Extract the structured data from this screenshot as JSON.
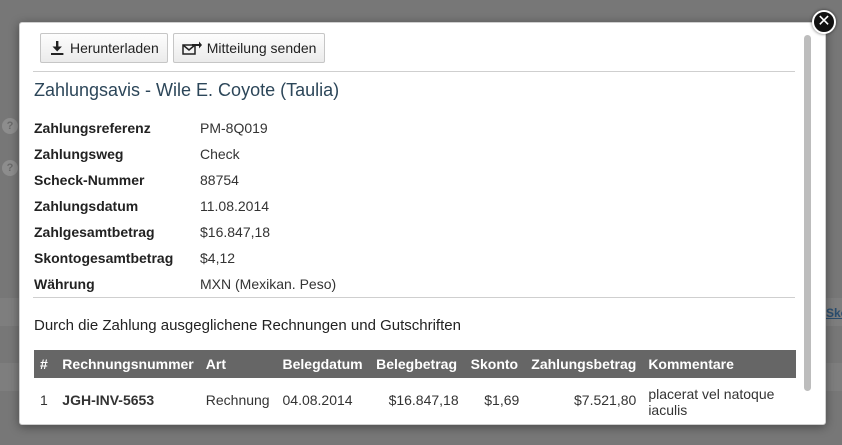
{
  "toolbar": {
    "download_label": "Herunterladen",
    "message_label": "Mitteilung senden"
  },
  "title": "Zahlungsavis - Wile E. Coyote (Taulia)",
  "fields": [
    {
      "label": "Zahlungsreferenz",
      "value": "PM-8Q019"
    },
    {
      "label": "Zahlungsweg",
      "value": "Check"
    },
    {
      "label": "Scheck-Nummer",
      "value": "88754"
    },
    {
      "label": "Zahlungsdatum",
      "value": "11.08.2014"
    },
    {
      "label": "Zahlgesamtbetrag",
      "value": "$16.847,18"
    },
    {
      "label": "Skontogesamtbetrag",
      "value": "$4,12"
    },
    {
      "label": "Währung",
      "value": "MXN (Mexikan. Peso)"
    }
  ],
  "invoices_heading": "Durch die Zahlung ausgeglichene Rechnungen und Gutschriften",
  "table": {
    "headers": [
      "#",
      "Rechnungsnummer",
      "Art",
      "Belegdatum",
      "Belegbetrag",
      "Skonto",
      "Zahlungsbetrag",
      "Kommentare"
    ],
    "rows": [
      {
        "index": "1",
        "number": "JGH-INV-5653",
        "type": "Rechnung",
        "doc_date": "04.08.2014",
        "doc_amount": "$16.847,18",
        "discount": "$1,69",
        "payment": "$7.521,80",
        "comment": "placerat vel natoque iaculis"
      }
    ]
  },
  "background": {
    "link_fragment": "Sko",
    "help_glyph": "?"
  },
  "colors": {
    "title": "#2c4659",
    "table_header_bg": "#666666",
    "link": "#1f6aa8"
  },
  "icons": [
    "download-icon",
    "send-message-icon",
    "close-icon"
  ]
}
